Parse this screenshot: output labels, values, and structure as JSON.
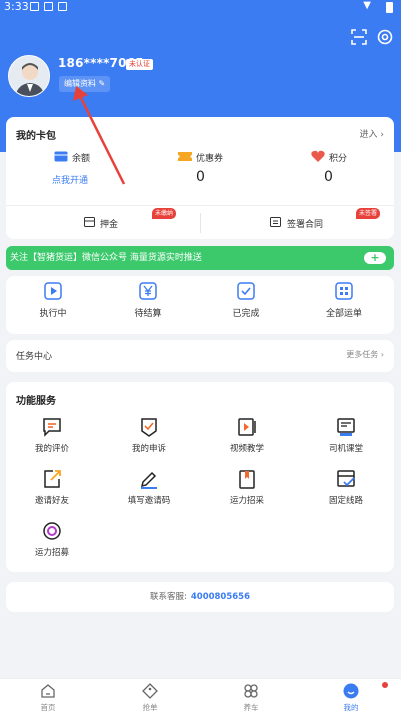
{
  "status_bar": {
    "time": "3:33"
  },
  "profile": {
    "phone": "186****7065",
    "verify_badge": "未认证",
    "edit_label": "编辑资料"
  },
  "wallet": {
    "title": "我的卡包",
    "more": "进入",
    "balance_label": "余额",
    "balance_link": "点我开通",
    "coupon_label": "优惠券",
    "coupon_value": "0",
    "points_label": "积分",
    "points_value": "0",
    "deposit_label": "押金",
    "deposit_tag": "未缴纳",
    "contract_label": "签署合同",
    "contract_tag": "未签署"
  },
  "banner": {
    "text": "关注【智猪货运】微信公众号 海量货源实时推送"
  },
  "orders": [
    {
      "label": "执行中",
      "icon": "play-icon"
    },
    {
      "label": "待结算",
      "icon": "yen-icon"
    },
    {
      "label": "已完成",
      "icon": "check-icon"
    },
    {
      "label": "全部运单",
      "icon": "grid-icon"
    }
  ],
  "tasks": {
    "title": "任务中心",
    "more": "更多任务"
  },
  "services": {
    "title": "功能服务",
    "items": [
      {
        "label": "我的评价",
        "icon": "chat-icon"
      },
      {
        "label": "我的申诉",
        "icon": "appeal-icon"
      },
      {
        "label": "视频教学",
        "icon": "video-icon"
      },
      {
        "label": "司机课堂",
        "icon": "classroom-icon"
      },
      {
        "label": "邀请好友",
        "icon": "invite-icon"
      },
      {
        "label": "填写邀请码",
        "icon": "pen-icon"
      },
      {
        "label": "运力招采",
        "icon": "bookmark-icon"
      },
      {
        "label": "固定线路",
        "icon": "route-icon"
      },
      {
        "label": "运力招募",
        "icon": "target-icon"
      }
    ]
  },
  "contact": {
    "label": "联系客服:",
    "number": "4000805656"
  },
  "tabs": [
    {
      "label": "首页",
      "icon": "home-icon"
    },
    {
      "label": "抢单",
      "icon": "tag-icon"
    },
    {
      "label": "养车",
      "icon": "clover-icon"
    },
    {
      "label": "我的",
      "icon": "user-icon"
    }
  ],
  "colors": {
    "primary": "#3b7cf2",
    "banner": "#3cc96c",
    "alert": "#e8413a"
  }
}
